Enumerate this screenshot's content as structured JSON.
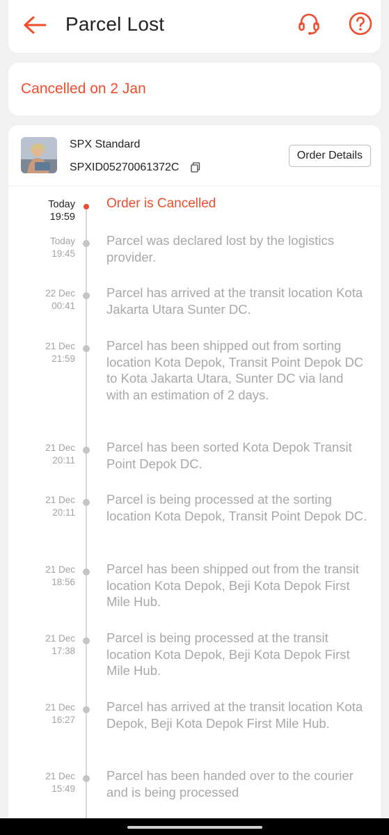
{
  "header": {
    "title": "Parcel Lost",
    "back_icon": "back-arrow-icon",
    "support_icon": "headset-icon",
    "help_icon": "help-circle-icon",
    "accent": "#ee4d2d"
  },
  "status": {
    "text": "Cancelled on 2 Jan"
  },
  "shipment": {
    "carrier": "SPX Standard",
    "tracking_number": "SPXID05270061372C",
    "copy_icon": "copy-icon",
    "order_details_label": "Order Details"
  },
  "timeline": [
    {
      "date": "Today",
      "time": "19:59",
      "text": "Order is Cancelled",
      "active": true
    },
    {
      "date": "Today",
      "time": "19:45",
      "text": "Parcel was declared lost by the logistics provider."
    },
    {
      "date": "22 Dec",
      "time": "00:41",
      "text": "Parcel has arrived at the transit location Kota Jakarta Utara Sunter DC."
    },
    {
      "date": "21 Dec",
      "time": "21:59",
      "text": "Parcel has been shipped out from sorting location Kota Depok, Transit Point Depok DC to Kota Jakarta Utara, Sunter DC via land with an estimation of 2 days."
    },
    {
      "date": "21 Dec",
      "time": "20:11",
      "text": "Parcel has been sorted Kota Depok Transit Point Depok DC."
    },
    {
      "date": "21 Dec",
      "time": "20:11",
      "text": "Parcel is being processed at the sorting location Kota Depok, Transit Point Depok DC."
    },
    {
      "date": "21 Dec",
      "time": "18:56",
      "text": "Parcel has been shipped out from the transit location Kota Depok, Beji Kota Depok First Mile Hub."
    },
    {
      "date": "21 Dec",
      "time": "17:38",
      "text": "Parcel is being processed at the transit location Kota Depok, Beji Kota Depok First Mile Hub."
    },
    {
      "date": "21 Dec",
      "time": "16:27",
      "text": "Parcel has arrived at the transit location Kota Depok, Beji Kota Depok First Mile Hub."
    },
    {
      "date": "21 Dec",
      "time": "15:49",
      "text": "Parcel has been handed over to the courier and is being processed"
    }
  ]
}
